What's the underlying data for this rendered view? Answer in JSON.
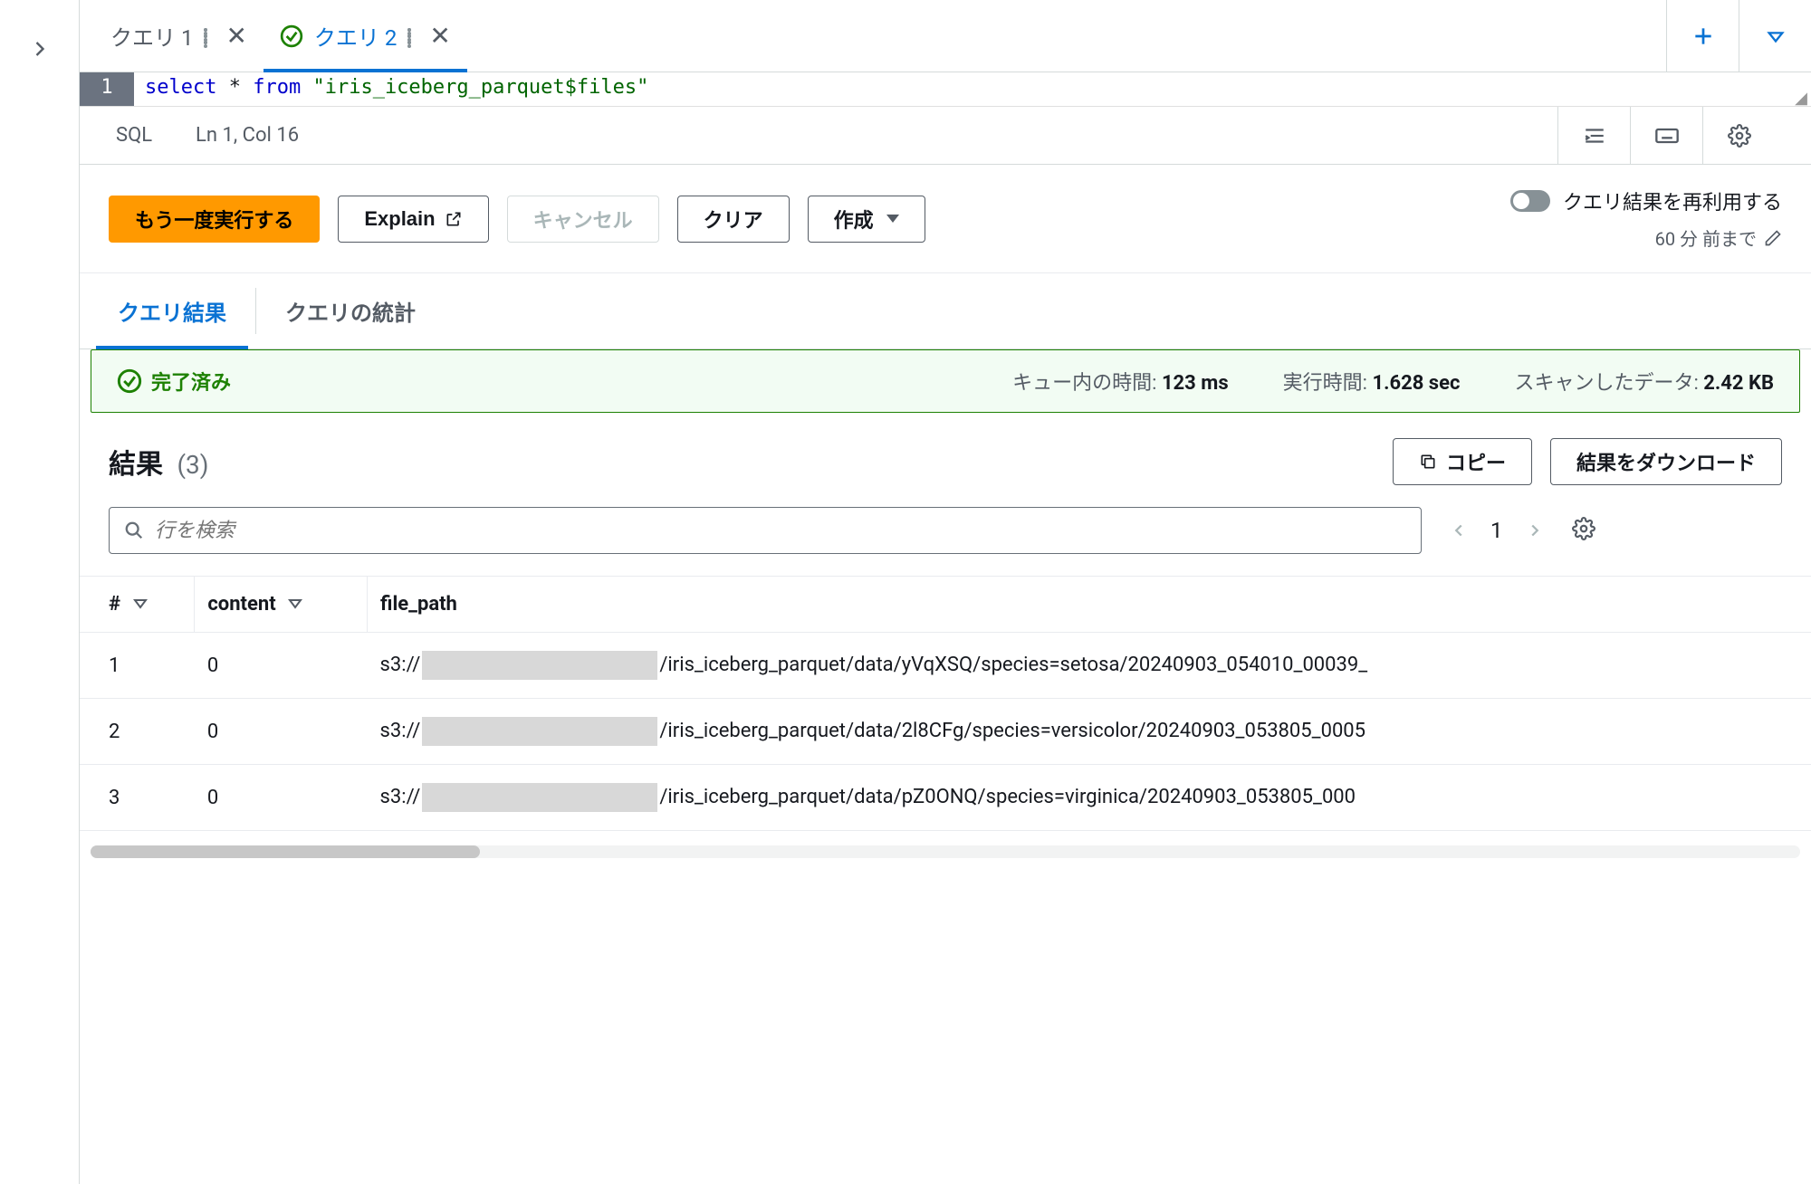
{
  "tabs": [
    {
      "label": "クエリ 1",
      "active": false,
      "status": null
    },
    {
      "label": "クエリ 2",
      "active": true,
      "status": "success"
    }
  ],
  "editor": {
    "line_num": "1",
    "sql_kw1": "select",
    "sql_star": " * ",
    "sql_kw2": "from",
    "sql_str": "\"iris_iceberg_parquet$files\""
  },
  "statusbar": {
    "lang": "SQL",
    "pos": "Ln 1, Col 16"
  },
  "actions": {
    "run_again": "もう一度実行する",
    "explain": "Explain",
    "cancel": "キャンセル",
    "clear": "クリア",
    "create": "作成",
    "reuse_label": "クエリ結果を再利用する",
    "reuse_sub": "60 分 前まで"
  },
  "result_tabs": {
    "results": "クエリ結果",
    "stats": "クエリの統計"
  },
  "banner": {
    "completed": "完了済み",
    "queue_lbl": "キュー内の時間:",
    "queue_val": "123 ms",
    "run_lbl": "実行時間:",
    "run_val": "1.628 sec",
    "scan_lbl": "スキャンしたデータ:",
    "scan_val": "2.42 KB"
  },
  "results": {
    "title": "結果",
    "count": "(3)",
    "copy": "コピー",
    "download": "結果をダウンロード",
    "search_placeholder": "行を検索",
    "page": "1",
    "columns": {
      "idx": "#",
      "c1": "content",
      "c2": "file_path"
    },
    "rows": [
      {
        "n": "1",
        "content": "0",
        "fp_pre": "s3://",
        "fp_post": "/iris_iceberg_parquet/data/yVqXSQ/species=setosa/20240903_054010_00039_"
      },
      {
        "n": "2",
        "content": "0",
        "fp_pre": "s3://",
        "fp_post": "/iris_iceberg_parquet/data/2l8CFg/species=versicolor/20240903_053805_0005"
      },
      {
        "n": "3",
        "content": "0",
        "fp_pre": "s3://",
        "fp_post": "/iris_iceberg_parquet/data/pZ0ONQ/species=virginica/20240903_053805_000"
      }
    ]
  }
}
